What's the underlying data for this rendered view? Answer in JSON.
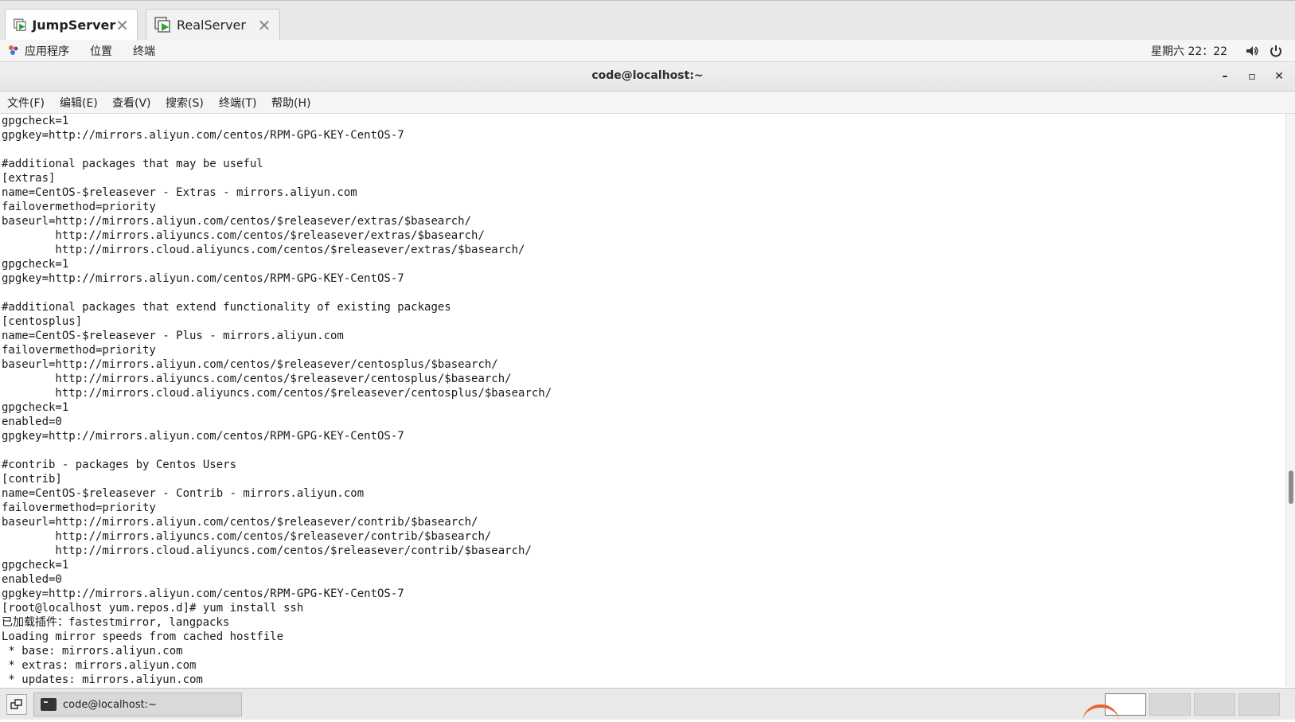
{
  "tabs": [
    {
      "label": "JumpServer",
      "active": true
    },
    {
      "label": "RealServer",
      "active": false
    }
  ],
  "icons": {
    "tab_vm": "vm-icon",
    "close": "close-icon",
    "apps": "apps-icon",
    "volume": "volume-icon",
    "power": "power-icon",
    "minimize": "minimize-icon",
    "maximize": "maximize-icon",
    "terminal": "terminal-icon"
  },
  "colors": {
    "vm_green": "#2aa02a",
    "accent_orange": "#e8632b"
  },
  "gnome": {
    "apps": "应用程序",
    "places": "位置",
    "terminal": "终端",
    "clock": "星期六 22：22"
  },
  "window": {
    "title": "code@localhost:~",
    "minimize": "–",
    "maximize": "▫",
    "close": "✕"
  },
  "menu": [
    "文件(F)",
    "编辑(E)",
    "查看(V)",
    "搜索(S)",
    "终端(T)",
    "帮助(H)"
  ],
  "terminal_lines": [
    "gpgcheck=1",
    "gpgkey=http://mirrors.aliyun.com/centos/RPM-GPG-KEY-CentOS-7",
    "",
    "#additional packages that may be useful",
    "[extras]",
    "name=CentOS-$releasever - Extras - mirrors.aliyun.com",
    "failovermethod=priority",
    "baseurl=http://mirrors.aliyun.com/centos/$releasever/extras/$basearch/",
    "        http://mirrors.aliyuncs.com/centos/$releasever/extras/$basearch/",
    "        http://mirrors.cloud.aliyuncs.com/centos/$releasever/extras/$basearch/",
    "gpgcheck=1",
    "gpgkey=http://mirrors.aliyun.com/centos/RPM-GPG-KEY-CentOS-7",
    "",
    "#additional packages that extend functionality of existing packages",
    "[centosplus]",
    "name=CentOS-$releasever - Plus - mirrors.aliyun.com",
    "failovermethod=priority",
    "baseurl=http://mirrors.aliyun.com/centos/$releasever/centosplus/$basearch/",
    "        http://mirrors.aliyuncs.com/centos/$releasever/centosplus/$basearch/",
    "        http://mirrors.cloud.aliyuncs.com/centos/$releasever/centosplus/$basearch/",
    "gpgcheck=1",
    "enabled=0",
    "gpgkey=http://mirrors.aliyun.com/centos/RPM-GPG-KEY-CentOS-7",
    "",
    "#contrib - packages by Centos Users",
    "[contrib]",
    "name=CentOS-$releasever - Contrib - mirrors.aliyun.com",
    "failovermethod=priority",
    "baseurl=http://mirrors.aliyun.com/centos/$releasever/contrib/$basearch/",
    "        http://mirrors.aliyuncs.com/centos/$releasever/contrib/$basearch/",
    "        http://mirrors.cloud.aliyuncs.com/centos/$releasever/contrib/$basearch/",
    "gpgcheck=1",
    "enabled=0",
    "gpgkey=http://mirrors.aliyun.com/centos/RPM-GPG-KEY-CentOS-7",
    "[root@localhost yum.repos.d]# yum install ssh",
    "已加载插件：fastestmirror, langpacks",
    "Loading mirror speeds from cached hostfile",
    " * base: mirrors.aliyun.com",
    " * extras: mirrors.aliyun.com",
    " * updates: mirrors.aliyun.com"
  ],
  "taskbar": {
    "task_label": "code@localhost:~",
    "workspaces": 4,
    "active_workspace": 1
  }
}
